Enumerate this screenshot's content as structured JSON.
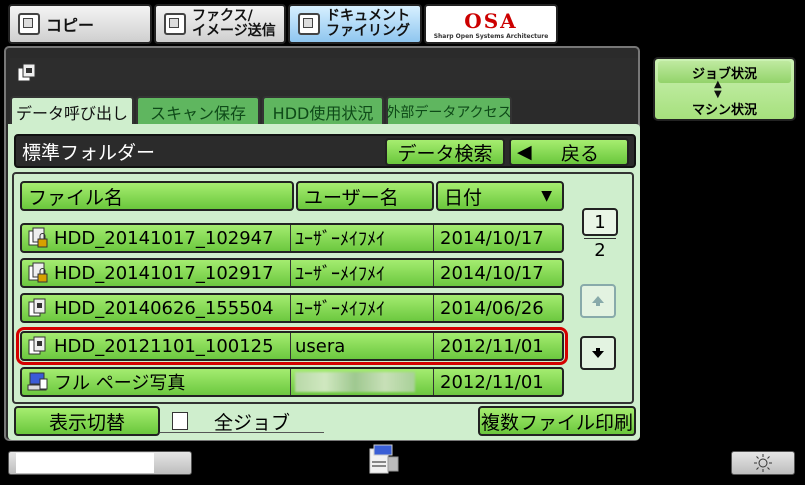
{
  "mode_tabs": [
    {
      "label": "コピー"
    },
    {
      "line1": "ファクス/",
      "line2": "イメージ送信"
    },
    {
      "line1": "ドキュメント",
      "line2": "ファイリング"
    }
  ],
  "brand": {
    "logo_text": "OSA",
    "logo_sub": "Sharp Open Systems Architecture"
  },
  "sub_tabs": [
    "データ呼び出し",
    "スキャン保存",
    "HDD使用状況",
    "外部データアクセス"
  ],
  "folder": {
    "title": "標準フォルダー",
    "search_label": "データ検索",
    "back_label": "戻る",
    "back_arrow": "◀"
  },
  "columns": {
    "filename": "ファイル名",
    "user": "ユーザー名",
    "date": "日付",
    "sort_arrow": "▼"
  },
  "rows": [
    {
      "icon": "locked-doc-icon",
      "name": "HDD_20141017_102947",
      "user": "ﾕｰｻﾞｰﾒｲﾌﾒｲ",
      "date": "2014/10/17"
    },
    {
      "icon": "locked-doc-icon",
      "name": "HDD_20141017_102917",
      "user": "ﾕｰｻﾞｰﾒｲﾌﾒｲ",
      "date": "2014/10/17"
    },
    {
      "icon": "doc-icon",
      "name": "HDD_20140626_155504",
      "user": "ﾕｰｻﾞｰﾒｲﾌﾒｲ",
      "date": "2014/06/26"
    },
    {
      "icon": "doc-icon",
      "name": "HDD_20121101_100125",
      "user": "usera",
      "date": "2012/11/01"
    },
    {
      "icon": "pc-doc-icon",
      "name": "フル ページ写真",
      "user": "",
      "date": "2012/11/01"
    }
  ],
  "pagination": {
    "current": "1",
    "total": "2"
  },
  "bottom": {
    "toggle_label": "表示切替",
    "all_jobs_label": "全ジョブ",
    "multi_print_label": "複数ファイル印刷"
  },
  "side": {
    "job_status": "ジョブ状況",
    "machine_status": "マシン状況"
  },
  "colors": {
    "selected_outline": "#d40000",
    "button_green": "#7fd14c",
    "content_bg": "#cfeecd"
  }
}
